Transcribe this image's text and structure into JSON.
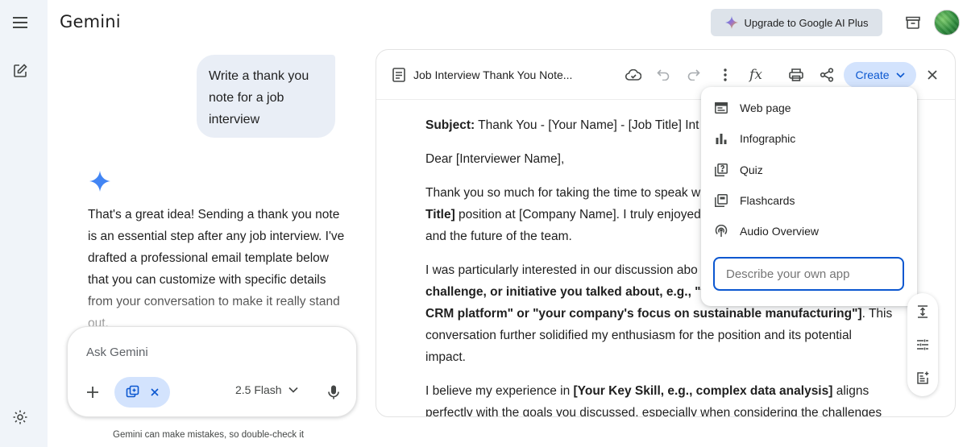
{
  "app": {
    "brand": "Gemini",
    "upgrade_label": "Upgrade to Google AI Plus"
  },
  "chat": {
    "user_message": "Write a thank you note for a job interview",
    "reply": "That's a great idea! Sending a thank you note is an essential step after any job interview. I've drafted a professional email template below that you can customize with specific details from your conversation to make it really stand out."
  },
  "input": {
    "placeholder": "Ask Gemini",
    "model_label": "2.5 Flash"
  },
  "disclaimer": "Gemini can make mistakes, so double-check it",
  "canvas": {
    "title": "Job Interview Thank You Note...",
    "create_label": "Create",
    "doc": {
      "subject_label": "Subject:",
      "subject_text": " Thank You - [Your Name] - [Job Title] Int",
      "greeting": "Dear [Interviewer Name],",
      "p1_line1": "Thank you so much for taking the time to speak w",
      "p1_line2_bold": "Title]",
      "p1_line2_rest": " position at [Company Name]. I truly enjoyed",
      "p1_line3": "and the future of the team.",
      "p2_line1": "I was particularly interested in our discussion abo",
      "p2_line2_bold": "challenge, or initiative you talked about, e.g., \"th",
      "p2_line3_bold": "CRM platform\" or \"your company's focus on sustainable manufacturing\"]",
      "p2_line3_rest": ". This",
      "p2_line4": "conversation further solidified my enthusiasm for the position and its potential",
      "p2_line5": "impact.",
      "p3_line1_start": "I believe my experience in ",
      "p3_line1_bold": "[Your Key Skill, e.g., complex data analysis]",
      "p3_line1_rest": " aligns",
      "p3_line2": "perfectly with the goals you discussed, especially when considering the challenges"
    }
  },
  "create_menu": {
    "items": [
      {
        "label": "Web page",
        "icon": "web-page-icon"
      },
      {
        "label": "Infographic",
        "icon": "bar-chart-icon"
      },
      {
        "label": "Quiz",
        "icon": "quiz-icon"
      },
      {
        "label": "Flashcards",
        "icon": "flashcards-icon"
      },
      {
        "label": "Audio Overview",
        "icon": "podcast-icon"
      }
    ],
    "input_placeholder": "Describe your own app"
  },
  "colors": {
    "accent": "#0b57d0",
    "chip_bg": "#d3e3fd",
    "rail_bg": "#f0f4f9",
    "bubble_bg": "#e9eef6"
  }
}
